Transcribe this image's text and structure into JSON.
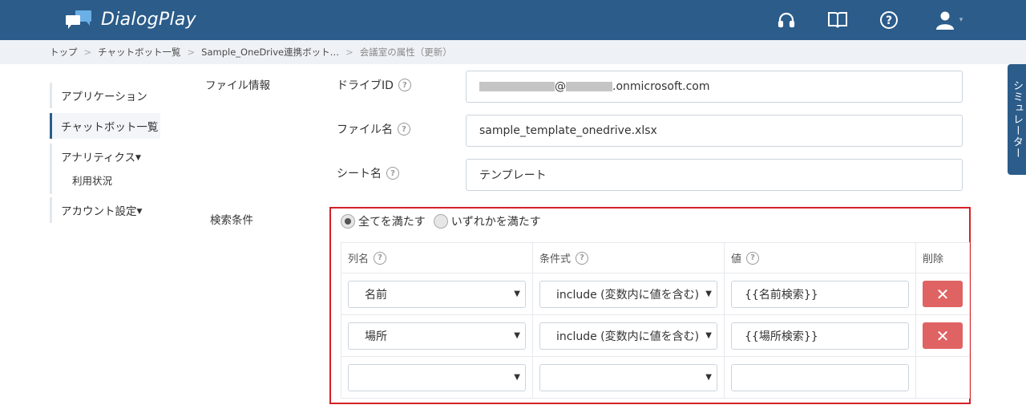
{
  "header": {
    "app_name": "DialogPlay",
    "icons": [
      "headset-icon",
      "book-icon",
      "help-icon",
      "user-icon"
    ]
  },
  "breadcrumb": {
    "items": [
      "トップ",
      "チャットボット一覧",
      "Sample_OneDrive連携ボット…"
    ],
    "separator": ">",
    "current": "会議室の属性（更新）"
  },
  "sidebar": {
    "items": [
      {
        "label": "アプリケーション"
      },
      {
        "label": "チャットボット一覧",
        "active": true
      },
      {
        "label": "アナリティクス"
      },
      {
        "label": "利用状況"
      },
      {
        "label": "アカウント設定"
      }
    ]
  },
  "file_info": {
    "section_label": "ファイル情報",
    "drive_id_label": "ドライブID",
    "drive_id_value": "@ .onmicrosoft.com",
    "drive_id_suffix": ".onmicrosoft.com",
    "drive_id_at": "@",
    "file_name_label": "ファイル名",
    "file_name_value": "sample_template_onedrive.xlsx",
    "sheet_name_label": "シート名",
    "sheet_name_value": "テンプレート"
  },
  "search": {
    "section_label": "検索条件",
    "radio_all": "全てを満たす",
    "radio_any": "いずれかを満たす",
    "selected": "all",
    "columns": {
      "col_name": "列名",
      "condition": "条件式",
      "value": "値",
      "delete": "削除"
    },
    "rows": [
      {
        "col": "名前",
        "cond": "include (変数内に値を含む)",
        "value": "{{名前検索}}"
      },
      {
        "col": "場所",
        "cond": "include (変数内に値を含む)",
        "value": "{{場所検索}}"
      },
      {
        "col": "",
        "cond": "",
        "value": ""
      }
    ],
    "delete_symbol": "✕"
  },
  "simulator": {
    "label": "シミュレーター"
  },
  "colors": {
    "header": "#2b5c8a",
    "accent_border": "#d32027",
    "delete_button": "#e06363"
  }
}
